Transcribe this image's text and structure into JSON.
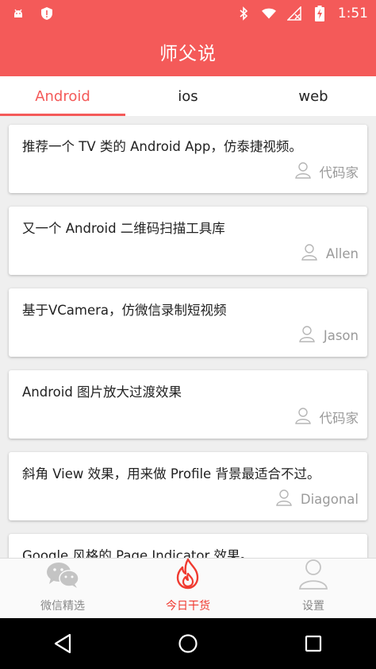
{
  "status_bar": {
    "time": "1:51",
    "left_icons": [
      "android-debug-icon",
      "shield-alert-icon"
    ],
    "right_icons": [
      "bluetooth-icon",
      "wifi-icon",
      "no-signal-icon",
      "battery-charging-icon"
    ]
  },
  "app_bar": {
    "title": "师父说"
  },
  "tabs": [
    {
      "label": "Android",
      "active": true
    },
    {
      "label": "ios",
      "active": false
    },
    {
      "label": "web",
      "active": false
    }
  ],
  "cards": [
    {
      "title": "推荐一个 TV 类的 Android App，仿泰捷视频。",
      "author": "代码家"
    },
    {
      "title": "又一个 Android 二维码扫描工具库",
      "author": "Allen"
    },
    {
      "title": "基于VCamera，仿微信录制短视频",
      "author": "Jason"
    },
    {
      "title": "Android 图片放大过渡效果",
      "author": "代码家"
    },
    {
      "title": "斜角 View 效果，用来做 Profile 背景最适合不过。",
      "author": "Diagonal"
    },
    {
      "title": "Google 风格的 Page Indicator 效果。",
      "author": ""
    }
  ],
  "bottom_nav": [
    {
      "label": "微信精选",
      "icon": "wechat-icon",
      "active": false
    },
    {
      "label": "今日干货",
      "icon": "fire-icon",
      "active": true
    },
    {
      "label": "设置",
      "icon": "person-icon",
      "active": false
    }
  ],
  "colors": {
    "primary": "#f45a59",
    "active_nav": "#f03a30",
    "inactive": "#aaaaaa"
  }
}
